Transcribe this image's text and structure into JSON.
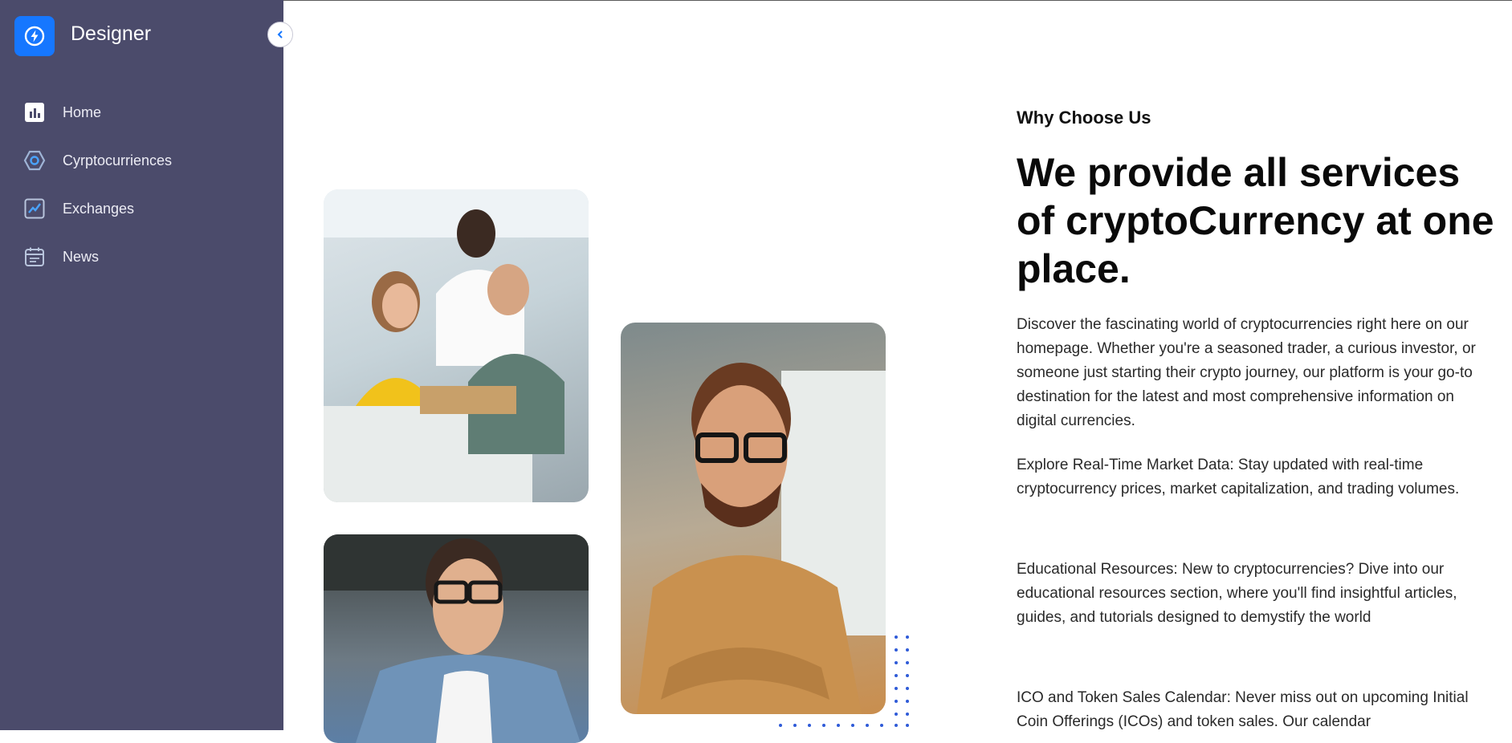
{
  "sidebar": {
    "brand": "Designer",
    "items": [
      {
        "label": "Home",
        "icon": "bar-chart-icon"
      },
      {
        "label": "Cyrptocurriences",
        "icon": "hexagon-icon"
      },
      {
        "label": "Exchanges",
        "icon": "line-chart-icon"
      },
      {
        "label": "News",
        "icon": "calendar-icon"
      }
    ]
  },
  "main": {
    "eyebrow": "Why Choose Us",
    "headline": "We provide all services of cryptoCurrency at one place.",
    "paragraphs": [
      "Discover the fascinating world of cryptocurrencies right here on our homepage. Whether you're a seasoned trader, a curious investor, or someone just starting their crypto journey, our platform is your go-to destination for the latest and most comprehensive information on digital currencies.",
      "Explore Real-Time Market Data: Stay updated with real-time cryptocurrency prices, market capitalization, and trading volumes.",
      "Educational Resources: New to cryptocurrencies? Dive into our educational resources section, where you'll find insightful articles, guides, and tutorials designed to demystify the world",
      "ICO and Token Sales Calendar: Never miss out on upcoming Initial Coin Offerings (ICOs) and token sales. Our calendar"
    ]
  },
  "colors": {
    "sidebar_bg": "#4b4b6b",
    "accent": "#1677ff",
    "dots": "#2f5bd8"
  }
}
